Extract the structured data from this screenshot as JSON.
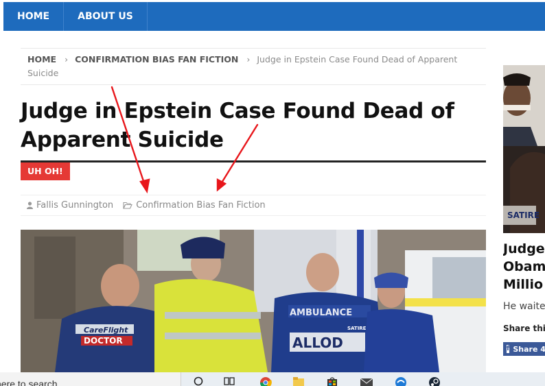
{
  "nav": {
    "items": [
      "HOME",
      "ABOUT US"
    ]
  },
  "breadcrumb": {
    "home": "HOME",
    "category": "CONFIRMATION BIAS FAN FICTION",
    "current": "Judge in Epstein Case Found Dead of Apparent Suicide"
  },
  "post": {
    "title_line1": "Judge in Epstein Case Found Dead of",
    "title_line2": "Apparent Suicide",
    "badge": "UH OH!",
    "author": "Fallis Gunnington",
    "category": "Confirmation Bias Fan Fiction"
  },
  "image": {
    "vest_text_1": "CareFlight",
    "vest_text_2": "DOCTOR",
    "vest_text_3": "AMBULANCE",
    "vest_text_4": "ALLOD",
    "vest_text_5": "SATIRE"
  },
  "sidebar": {
    "title_lines": [
      "Judge",
      "Obam",
      "Millio"
    ],
    "excerpt": "He waited",
    "share_label": "Share this",
    "share_button": "Share 4",
    "image_label": "SATIRE"
  },
  "taskbar": {
    "search_text": "here to search"
  },
  "colors": {
    "nav": "#1e6bbd",
    "badge": "#e53935",
    "arrow": "#e8161b",
    "facebook": "#3b5998"
  }
}
